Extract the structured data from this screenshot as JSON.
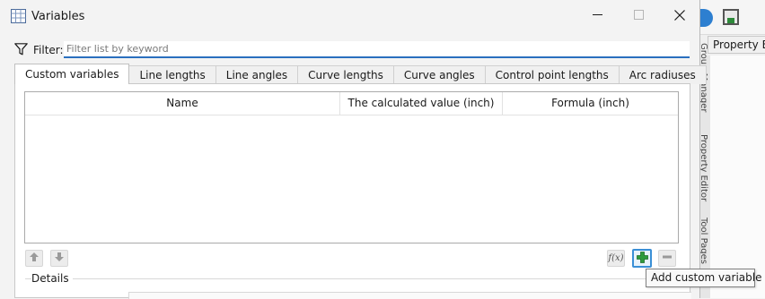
{
  "window": {
    "title": "Variables",
    "icon": "table-grid-icon",
    "controls": {
      "minimize": "minimize-icon",
      "maximize": "maximize-icon",
      "close": "close-icon"
    }
  },
  "filter": {
    "label": "Filter:",
    "icon": "funnel-icon",
    "placeholder": "Filter list by keyword",
    "value": ""
  },
  "tabs": [
    {
      "label": "Custom variables",
      "active": true
    },
    {
      "label": "Line lengths",
      "active": false
    },
    {
      "label": "Line angles",
      "active": false
    },
    {
      "label": "Curve lengths",
      "active": false
    },
    {
      "label": "Curve angles",
      "active": false
    },
    {
      "label": "Control point lengths",
      "active": false
    },
    {
      "label": "Arc radiuses",
      "active": false
    }
  ],
  "table": {
    "columns": [
      "Name",
      "The calculated value (inch)",
      "Formula (inch)"
    ],
    "rows": []
  },
  "toolbar": {
    "move_up": "arrow-up-icon",
    "move_down": "arrow-down-icon",
    "formula": "f(x)",
    "add": "plus-icon",
    "remove": "minus-icon",
    "add_tooltip": "Add custom variable"
  },
  "details": {
    "label": "Details"
  },
  "background_app": {
    "panel_tab": "Property Ec",
    "side_tabs": [
      "Group Manager",
      "Property Editor",
      "Tool Pages"
    ]
  },
  "colors": {
    "accent": "#2a6fbf",
    "add_button_border": "#3a8fd6",
    "add_icon": "#2e9a3c"
  }
}
